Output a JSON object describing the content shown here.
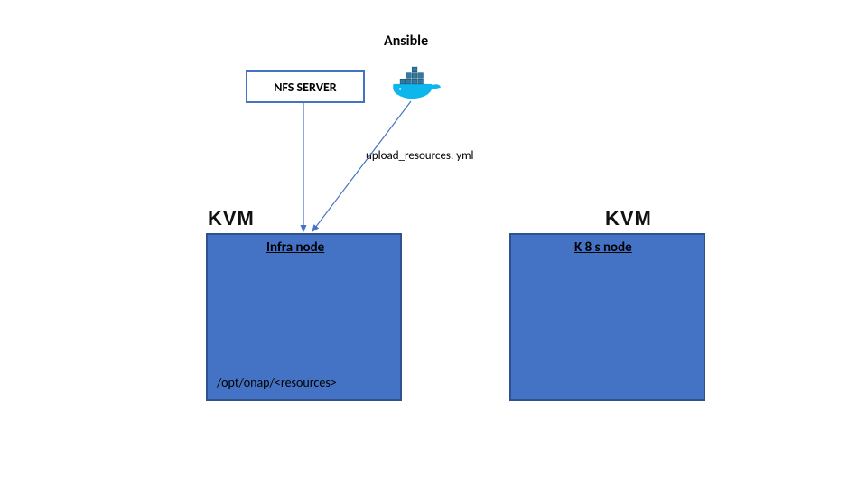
{
  "title": "Ansible",
  "nfs": {
    "label": "NFS SERVER"
  },
  "edges": {
    "upload_label": "upload_resources. yml"
  },
  "kvm": {
    "left_label": "KVM",
    "right_label": "KVM"
  },
  "infra": {
    "title": "Infra node",
    "path": "/opt/onap/<resources>"
  },
  "k8s": {
    "title": "K 8 s node"
  },
  "docker_icon": "docker-whale"
}
